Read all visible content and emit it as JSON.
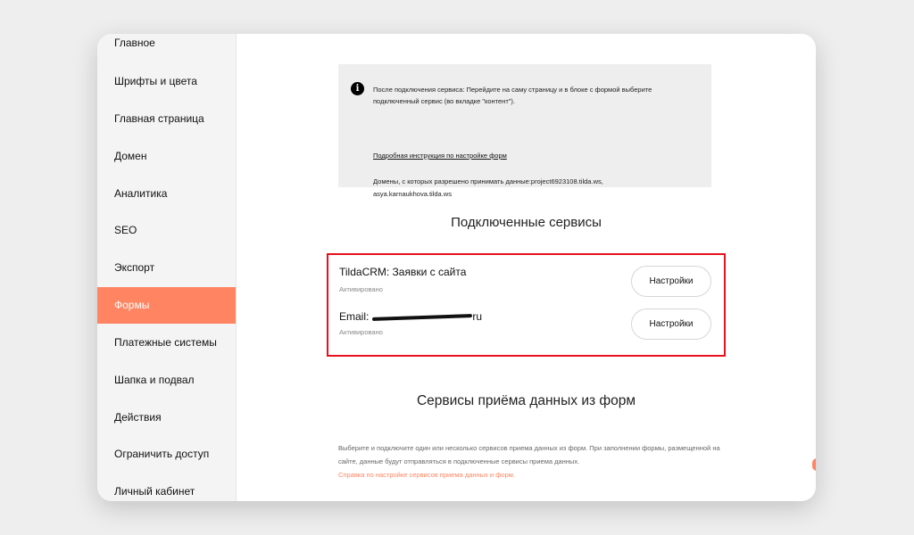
{
  "sidebar": {
    "items": [
      {
        "label": "Главное",
        "active": false
      },
      {
        "label": "Шрифты и цвета",
        "active": false
      },
      {
        "label": "Главная страница",
        "active": false
      },
      {
        "label": "Домен",
        "active": false
      },
      {
        "label": "Аналитика",
        "active": false
      },
      {
        "label": "SEO",
        "active": false
      },
      {
        "label": "Экспорт",
        "active": false
      },
      {
        "label": "Формы",
        "active": true
      },
      {
        "label": "Платежные системы",
        "active": false
      },
      {
        "label": "Шапка и подвал",
        "active": false
      },
      {
        "label": "Действия",
        "active": false
      },
      {
        "label": "Ограничить доступ",
        "active": false
      },
      {
        "label": "Личный кабинет",
        "active": false
      }
    ]
  },
  "notice": {
    "icon": "info-icon",
    "text": "После подключения сервиса: Перейдите на саму страницу и в блоке с формой выберите подключенный сервис (во вкладке \"контент\").",
    "link": "Подробная инструкция по настройке форм",
    "domains": "Домены, с которых разрешено принимать данные:project6923108.tilda.ws, asya.karnaukhova.tilda.ws"
  },
  "connected": {
    "title": "Подключенные сервисы",
    "services": [
      {
        "name": "TildaCRM: Заявки с сайта",
        "status": "Активировано",
        "button": "Настройки"
      },
      {
        "name_prefix": "Email:",
        "name_suffix": "ru",
        "status": "Активировано",
        "button": "Настройки"
      }
    ]
  },
  "receivers": {
    "title": "Сервисы приёма данных из форм",
    "description": "Выберите и подключите один или несколько сервисов приема данных из форм. При заполнении формы, размещенной на сайте, данные будут отправляться в подключенные сервисы приема данных.",
    "help_link": "Справка по настройке сервисов приема данных и форм."
  },
  "colors": {
    "accent": "#ff8562",
    "highlight_border": "#e8101e",
    "notice_bg": "#eeeeee",
    "sidebar_bg": "#f4f4f4"
  },
  "icons": {
    "video_help": "video-info-icon"
  }
}
